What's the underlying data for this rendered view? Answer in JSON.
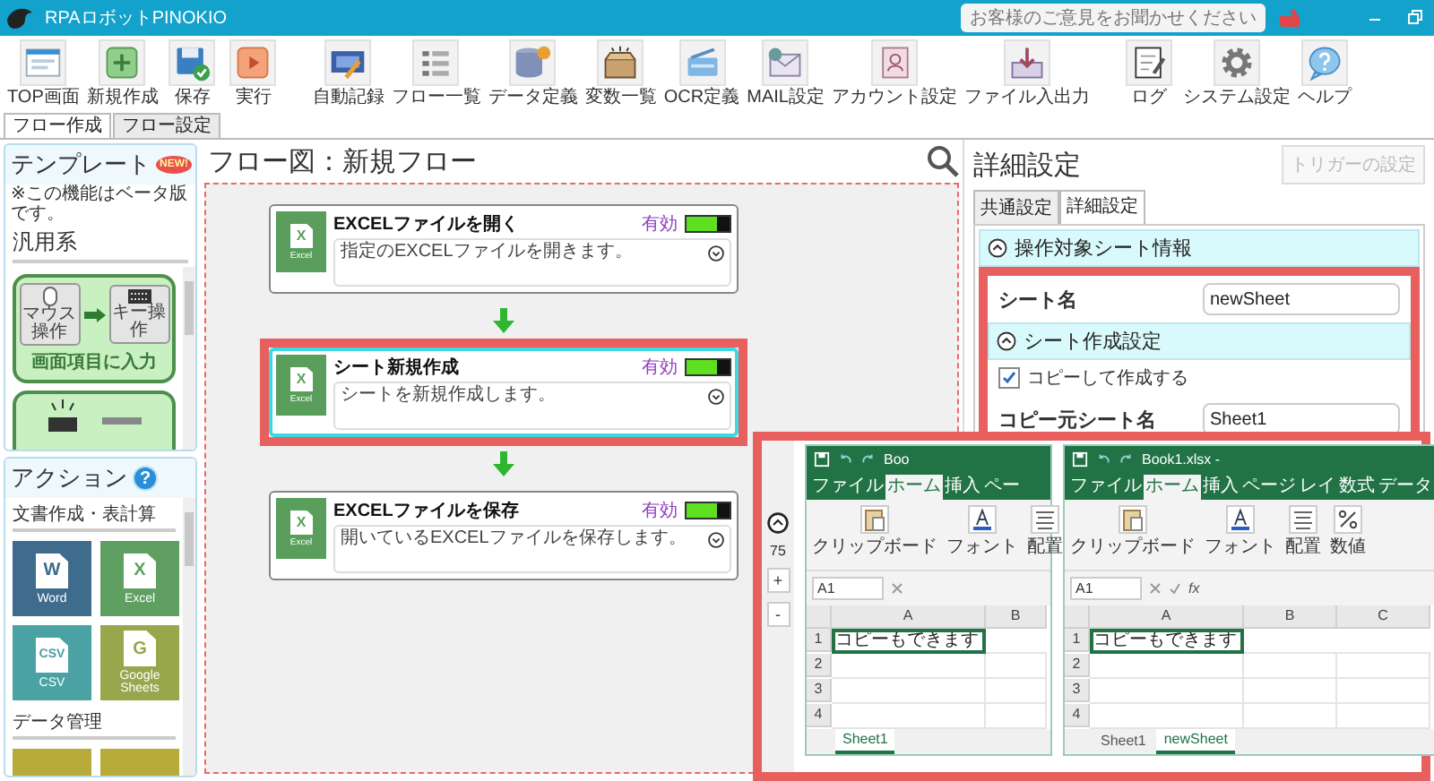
{
  "window": {
    "title": "RPAロボットPINOKIO",
    "feedback": "お客様のご意見をお聞かせください"
  },
  "toolbar": [
    [
      {
        "kind": "top",
        "label": "TOP画面"
      },
      {
        "kind": "new",
        "label": "新規作成"
      },
      {
        "kind": "save",
        "label": "保存"
      },
      {
        "kind": "run",
        "label": "実行"
      }
    ],
    [
      {
        "kind": "record",
        "label": "自動記録"
      },
      {
        "kind": "list",
        "label": "フロー一覧"
      },
      {
        "kind": "data",
        "label": "データ定義"
      },
      {
        "kind": "variable",
        "label": "変数一覧"
      },
      {
        "kind": "ocr",
        "label": "OCR定義"
      },
      {
        "kind": "mail",
        "label": "MAIL設定"
      },
      {
        "kind": "account",
        "label": "アカウント設定"
      },
      {
        "kind": "file",
        "label": "ファイル入出力"
      }
    ],
    [
      {
        "kind": "log",
        "label": "ログ"
      },
      {
        "kind": "settings",
        "label": "システム設定"
      },
      {
        "kind": "help",
        "label": "ヘルプ"
      }
    ]
  ],
  "main_tabs": [
    {
      "label": "フロー作成",
      "selected": true
    },
    {
      "label": "フロー設定",
      "selected": false
    }
  ],
  "templates": {
    "title": "テンプレート",
    "badge": "NEW!",
    "note": "※この機能はベータ版です。",
    "category": "汎用系",
    "cards": [
      {
        "kind": "input",
        "caption": "画面項目に入力",
        "from_label": "マウス操作",
        "to_label": "キー操作"
      },
      {
        "kind": "click"
      }
    ]
  },
  "actions": {
    "title": "アクション",
    "help": "?",
    "categories": [
      {
        "name": "文書作成・表計算",
        "tiles": [
          {
            "letter": "W",
            "label": "Word",
            "color": "#3f6b8c"
          },
          {
            "letter": "X",
            "label": "Excel",
            "color": "#5f9f62"
          },
          {
            "letter": "CSV",
            "label": "CSV",
            "color": "#4aa2a4"
          },
          {
            "letter": "G",
            "label": "Google Sheets",
            "color": "#98a64c"
          }
        ]
      },
      {
        "name": "データ管理",
        "tiles": [
          {
            "color": "#b9ab3a"
          },
          {
            "color": "#b9ab3a"
          }
        ]
      }
    ]
  },
  "flow": {
    "title": "フロー図：新規フロー",
    "zoom": "75",
    "zoom_in": "+",
    "zoom_out": "-",
    "nodes": [
      {
        "title": "EXCELファイルを開く",
        "description": "指定のEXCELファイルを開きます。",
        "icon_letter": "X",
        "icon_label": "Excel",
        "status": "有効",
        "enabled": true,
        "selected": false,
        "highlighted": false
      },
      {
        "title": "シート新規作成",
        "description": "シートを新規作成します。",
        "icon_letter": "X",
        "icon_label": "Excel",
        "status": "有効",
        "enabled": true,
        "selected": true,
        "highlighted": true
      },
      {
        "title": "EXCELファイルを保存",
        "description": "開いているEXCELファイルを保存します。",
        "icon_letter": "X",
        "icon_label": "Excel",
        "status": "有効",
        "enabled": true,
        "selected": false,
        "highlighted": false
      }
    ]
  },
  "details": {
    "title": "詳細設定",
    "trigger_button": "トリガーの設定",
    "trigger_disabled": true,
    "highlighted": true,
    "tabs": [
      {
        "label": "共通設定",
        "selected": false
      },
      {
        "label": "詳細設定",
        "selected": true
      }
    ],
    "sections": [
      {
        "title": "操作対象シート情報",
        "expanded": true,
        "fields": [
          {
            "kind": "text",
            "label": "シート名",
            "value": "newSheet"
          }
        ]
      },
      {
        "title": "シート作成設定",
        "expanded": true,
        "fields": [
          {
            "kind": "checkbox",
            "label": "コピーして作成する",
            "checked": true
          },
          {
            "kind": "text",
            "label": "コピー元シート名",
            "value": "Sheet1"
          }
        ]
      }
    ]
  },
  "preview": {
    "highlighted": true,
    "screenshots": [
      {
        "title": "Boo",
        "ribbon_tabs": [
          {
            "label": "ファイル",
            "selected": false
          },
          {
            "label": "ホーム",
            "selected": true
          },
          {
            "label": "挿入",
            "selected": false
          },
          {
            "label": "ペー",
            "selected": false
          }
        ],
        "groups": [
          {
            "kind": "clipboard",
            "label": "クリップボード"
          },
          {
            "kind": "font",
            "label": "フォント"
          },
          {
            "kind": "align",
            "label": "配置"
          }
        ],
        "name_box": "A1",
        "columns": [
          "A",
          "B"
        ],
        "rows": [
          "1",
          "2",
          "3",
          "4"
        ],
        "cell_text": "コピーもできます",
        "sheets": [
          {
            "label": "Sheet1",
            "selected": true
          }
        ]
      },
      {
        "title": "Book1.xlsx -",
        "ribbon_tabs": [
          {
            "label": "ファイル",
            "selected": false
          },
          {
            "label": "ホーム",
            "selected": true
          },
          {
            "label": "挿入",
            "selected": false
          },
          {
            "label": "ページ",
            "selected": false
          },
          {
            "label": "レイ",
            "selected": false
          },
          {
            "label": "数式",
            "selected": false
          },
          {
            "label": "データ",
            "selected": false
          }
        ],
        "groups": [
          {
            "kind": "clipboard",
            "label": "クリップボード"
          },
          {
            "kind": "font",
            "label": "フォント"
          },
          {
            "kind": "align",
            "label": "配置"
          },
          {
            "kind": "number",
            "label": "数値"
          }
        ],
        "name_box": "A1",
        "formula_label": "fx",
        "columns": [
          "A",
          "B",
          "C"
        ],
        "rows": [
          "1",
          "2",
          "3",
          "4"
        ],
        "cell_text": "コピーもできます",
        "sheets": [
          {
            "label": "Sheet1",
            "selected": false
          },
          {
            "label": "newSheet",
            "selected": true
          }
        ]
      }
    ]
  }
}
